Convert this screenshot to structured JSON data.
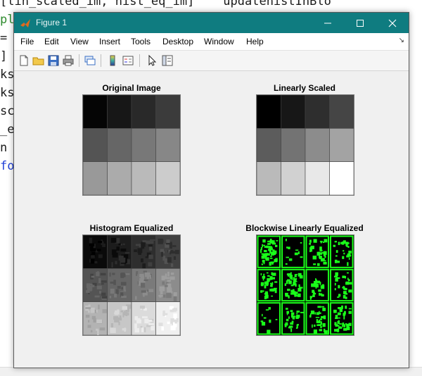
{
  "editor": {
    "lines": [
      {
        "text": "[lin_scaled_im, hist_eq_im]    updatehistInBlo",
        "color": "#1a1a1a"
      },
      {
        "text": "pl                                              k",
        "color": "#2e8b2e"
      },
      {
        "text": "=",
        "color": "#1a1a1a"
      },
      {
        "text": "]",
        "color": "#1a1a1a"
      },
      {
        "text": "ks",
        "color": "#1a1a1a"
      },
      {
        "text": "ks",
        "color": "#1a1a1a"
      },
      {
        "text": "sc",
        "color": "#1a1a1a"
      },
      {
        "text": "_e",
        "color": "#1a1a1a"
      },
      {
        "text": "n",
        "color": "#1a1a1a"
      },
      {
        "text": "fo",
        "color": "#1f3fd6"
      }
    ]
  },
  "window": {
    "title": "Figure 1",
    "titlebar_color": "#0f7c80",
    "icons": {
      "app": "matlab-logo-icon",
      "minimize": "minimize-icon",
      "maximize": "maximize-icon",
      "close": "close-icon"
    }
  },
  "menu": [
    "File",
    "Edit",
    "View",
    "Insert",
    "Tools",
    "Desktop",
    "Window",
    "Help"
  ],
  "toolbar": [
    "new-figure-icon",
    "open-file-icon",
    "save-icon",
    "print-icon",
    "link-plot-icon",
    "insert-colorbar-icon",
    "insert-legend-icon",
    "edit-plot-arrow-icon",
    "property-inspector-icon"
  ],
  "axes": [
    {
      "title": "Original Image",
      "gray_levels": [
        0.02,
        0.09,
        0.16,
        0.23,
        0.33,
        0.4,
        0.47,
        0.53,
        0.6,
        0.67,
        0.73,
        0.8
      ]
    },
    {
      "title": "Linearly Scaled",
      "gray_levels": [
        0.0,
        0.09,
        0.18,
        0.27,
        0.36,
        0.45,
        0.55,
        0.64,
        0.73,
        0.82,
        0.91,
        1.0
      ]
    },
    {
      "title": "Histogram Equalized",
      "gray_levels": [
        0.04,
        0.11,
        0.18,
        0.25,
        0.33,
        0.4,
        0.48,
        0.55,
        0.7,
        0.78,
        0.86,
        0.94
      ]
    },
    {
      "title": "Blockwise Linearly Equalized",
      "gray_levels": [],
      "accent": "#1aff1a"
    }
  ]
}
